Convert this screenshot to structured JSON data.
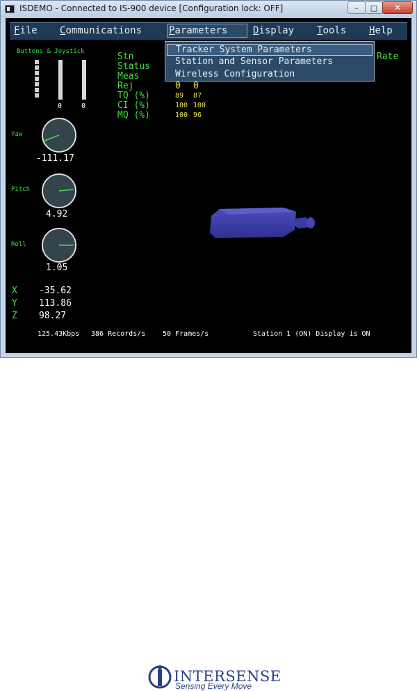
{
  "window": {
    "title": "ISDEMO - Connected to IS-900 device [Configuration lock: OFF]",
    "min_glyph": "–",
    "max_glyph": "□",
    "close_glyph": "✕"
  },
  "menu": {
    "file": {
      "acc": "F",
      "rest": "ile"
    },
    "communications": {
      "acc": "C",
      "rest": "ommunications"
    },
    "parameters": {
      "acc": "P",
      "rest": "arameters"
    },
    "display": {
      "acc": "D",
      "rest": "isplay"
    },
    "tools": {
      "acc": "T",
      "rest": "ools"
    },
    "help": {
      "acc": "H",
      "rest": "elp"
    }
  },
  "dropdown": {
    "items": [
      "Tracker System Parameters",
      "Station and Sensor Parameters",
      "Wireless Configuration"
    ]
  },
  "buttons_joystick": {
    "title": "Buttons & Joystick",
    "value1": "0",
    "value2": "0"
  },
  "station_table": {
    "labels": [
      "Stn",
      "Status",
      "Meas",
      "Rej",
      "TQ (%)",
      "CI (%)",
      "MQ (%)"
    ],
    "rate_label": "Rate",
    "rej_values": [
      "0",
      "0"
    ],
    "tq_values": [
      "89",
      "87"
    ],
    "ci_values": [
      "100",
      "100"
    ],
    "mq_values": [
      "100",
      "96"
    ]
  },
  "orientation": {
    "yaw_label": "Yaw",
    "yaw_value": "-111.17",
    "pitch_label": "Pitch",
    "pitch_value": "4.92",
    "roll_label": "Roll",
    "roll_value": "1.05"
  },
  "position": {
    "x_label": "X",
    "x_value": "-35.62",
    "y_label": "Y",
    "y_value": "113.86",
    "z_label": "Z",
    "z_value": "98.27"
  },
  "status_bar": {
    "bandwidth": "125.43Kbps",
    "records": "386 Records/s",
    "frames": "50 Frames/s",
    "station_status": "Station 1 (ON) Display is ON"
  },
  "logo": {
    "name": "INTERSENSE",
    "tagline": "Sensing Every Move"
  },
  "colors": {
    "label_green": "#3fe040",
    "value_yellow": "#f0e040",
    "menu_bg": "#1f3a56",
    "logo_blue": "#2a3f86"
  }
}
